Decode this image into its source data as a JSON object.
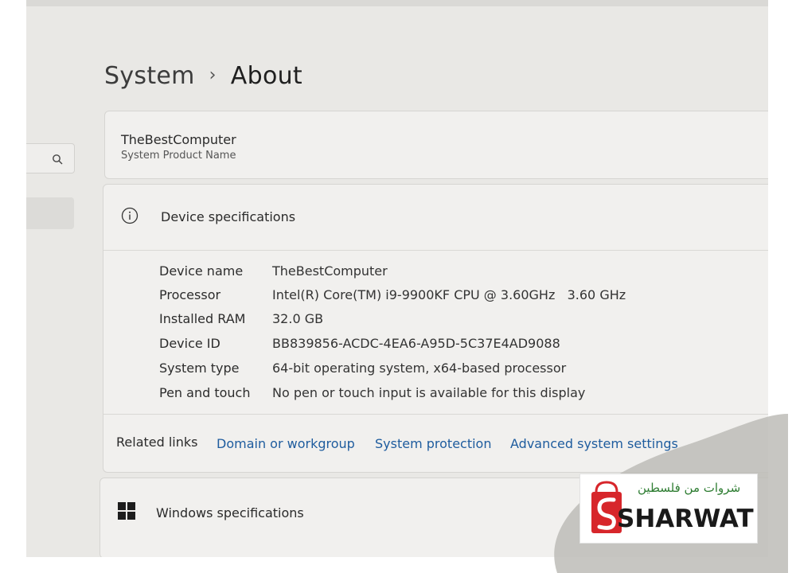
{
  "breadcrumb": {
    "parent": "System",
    "separator": "›",
    "current": "About"
  },
  "product": {
    "name": "TheBestComputer",
    "label": "System Product Name"
  },
  "device_specs": {
    "title": "Device specifications",
    "rows": [
      {
        "key": "Device name",
        "value": "TheBestComputer"
      },
      {
        "key": "Processor",
        "value": "Intel(R) Core(TM) i9-9900KF CPU @ 3.60GHz   3.60 GHz"
      },
      {
        "key": "Installed RAM",
        "value": "32.0 GB"
      },
      {
        "key": "Device ID",
        "value": "BB839856-ACDC-4EA6-A95D-5C37E4AD9088"
      },
      {
        "key": "System type",
        "value": "64-bit operating system, x64-based processor"
      },
      {
        "key": "Pen and touch",
        "value": "No pen or touch input is available for this display"
      }
    ]
  },
  "related_links": {
    "label": "Related links",
    "links": [
      "Domain or workgroup",
      "System protection",
      "Advanced system settings"
    ]
  },
  "windows_specs": {
    "title": "Windows specifications"
  },
  "watermark": {
    "arabic": "شروات من فلسطين",
    "brand": "SHARWAT"
  },
  "icons": {
    "search": "search-icon",
    "info": "info-icon",
    "windows": "windows-logo-icon",
    "bag": "shopping-bag-icon"
  },
  "colors": {
    "link": "#1e5c9e",
    "brand_red": "#d7262b",
    "brand_green": "#2e7d32"
  }
}
